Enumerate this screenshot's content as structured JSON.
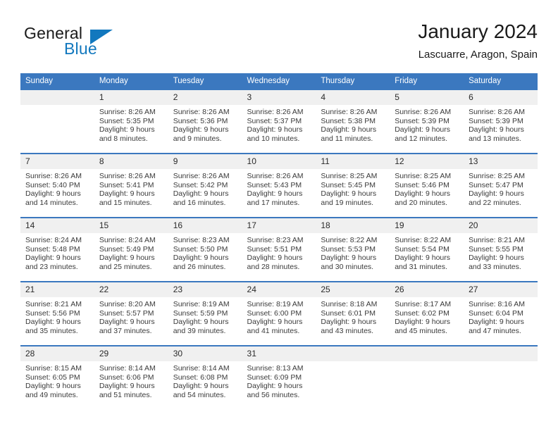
{
  "brand": {
    "name_part1": "General",
    "name_part2": "Blue",
    "color_primary": "#1278be",
    "icon": "triangle-logo"
  },
  "header": {
    "title": "January 2024",
    "subtitle": "Lascuarre, Aragon, Spain"
  },
  "theme": {
    "header_bar": "#3b78bf",
    "daynum_band": "#f0f0f0",
    "text": "#1a1a1a"
  },
  "weekday_headers": [
    "Sunday",
    "Monday",
    "Tuesday",
    "Wednesday",
    "Thursday",
    "Friday",
    "Saturday"
  ],
  "labels": {
    "sunrise_prefix": "Sunrise:",
    "sunset_prefix": "Sunset:",
    "daylight_prefix": "Daylight:"
  },
  "weeks": [
    [
      {
        "day": "",
        "l1": "",
        "l2": "",
        "l3": "",
        "l4": ""
      },
      {
        "day": "1",
        "l1": "Sunrise: 8:26 AM",
        "l2": "Sunset: 5:35 PM",
        "l3": "Daylight: 9 hours",
        "l4": "and 8 minutes."
      },
      {
        "day": "2",
        "l1": "Sunrise: 8:26 AM",
        "l2": "Sunset: 5:36 PM",
        "l3": "Daylight: 9 hours",
        "l4": "and 9 minutes."
      },
      {
        "day": "3",
        "l1": "Sunrise: 8:26 AM",
        "l2": "Sunset: 5:37 PM",
        "l3": "Daylight: 9 hours",
        "l4": "and 10 minutes."
      },
      {
        "day": "4",
        "l1": "Sunrise: 8:26 AM",
        "l2": "Sunset: 5:38 PM",
        "l3": "Daylight: 9 hours",
        "l4": "and 11 minutes."
      },
      {
        "day": "5",
        "l1": "Sunrise: 8:26 AM",
        "l2": "Sunset: 5:39 PM",
        "l3": "Daylight: 9 hours",
        "l4": "and 12 minutes."
      },
      {
        "day": "6",
        "l1": "Sunrise: 8:26 AM",
        "l2": "Sunset: 5:39 PM",
        "l3": "Daylight: 9 hours",
        "l4": "and 13 minutes."
      }
    ],
    [
      {
        "day": "7",
        "l1": "Sunrise: 8:26 AM",
        "l2": "Sunset: 5:40 PM",
        "l3": "Daylight: 9 hours",
        "l4": "and 14 minutes."
      },
      {
        "day": "8",
        "l1": "Sunrise: 8:26 AM",
        "l2": "Sunset: 5:41 PM",
        "l3": "Daylight: 9 hours",
        "l4": "and 15 minutes."
      },
      {
        "day": "9",
        "l1": "Sunrise: 8:26 AM",
        "l2": "Sunset: 5:42 PM",
        "l3": "Daylight: 9 hours",
        "l4": "and 16 minutes."
      },
      {
        "day": "10",
        "l1": "Sunrise: 8:26 AM",
        "l2": "Sunset: 5:43 PM",
        "l3": "Daylight: 9 hours",
        "l4": "and 17 minutes."
      },
      {
        "day": "11",
        "l1": "Sunrise: 8:25 AM",
        "l2": "Sunset: 5:45 PM",
        "l3": "Daylight: 9 hours",
        "l4": "and 19 minutes."
      },
      {
        "day": "12",
        "l1": "Sunrise: 8:25 AM",
        "l2": "Sunset: 5:46 PM",
        "l3": "Daylight: 9 hours",
        "l4": "and 20 minutes."
      },
      {
        "day": "13",
        "l1": "Sunrise: 8:25 AM",
        "l2": "Sunset: 5:47 PM",
        "l3": "Daylight: 9 hours",
        "l4": "and 22 minutes."
      }
    ],
    [
      {
        "day": "14",
        "l1": "Sunrise: 8:24 AM",
        "l2": "Sunset: 5:48 PM",
        "l3": "Daylight: 9 hours",
        "l4": "and 23 minutes."
      },
      {
        "day": "15",
        "l1": "Sunrise: 8:24 AM",
        "l2": "Sunset: 5:49 PM",
        "l3": "Daylight: 9 hours",
        "l4": "and 25 minutes."
      },
      {
        "day": "16",
        "l1": "Sunrise: 8:23 AM",
        "l2": "Sunset: 5:50 PM",
        "l3": "Daylight: 9 hours",
        "l4": "and 26 minutes."
      },
      {
        "day": "17",
        "l1": "Sunrise: 8:23 AM",
        "l2": "Sunset: 5:51 PM",
        "l3": "Daylight: 9 hours",
        "l4": "and 28 minutes."
      },
      {
        "day": "18",
        "l1": "Sunrise: 8:22 AM",
        "l2": "Sunset: 5:53 PM",
        "l3": "Daylight: 9 hours",
        "l4": "and 30 minutes."
      },
      {
        "day": "19",
        "l1": "Sunrise: 8:22 AM",
        "l2": "Sunset: 5:54 PM",
        "l3": "Daylight: 9 hours",
        "l4": "and 31 minutes."
      },
      {
        "day": "20",
        "l1": "Sunrise: 8:21 AM",
        "l2": "Sunset: 5:55 PM",
        "l3": "Daylight: 9 hours",
        "l4": "and 33 minutes."
      }
    ],
    [
      {
        "day": "21",
        "l1": "Sunrise: 8:21 AM",
        "l2": "Sunset: 5:56 PM",
        "l3": "Daylight: 9 hours",
        "l4": "and 35 minutes."
      },
      {
        "day": "22",
        "l1": "Sunrise: 8:20 AM",
        "l2": "Sunset: 5:57 PM",
        "l3": "Daylight: 9 hours",
        "l4": "and 37 minutes."
      },
      {
        "day": "23",
        "l1": "Sunrise: 8:19 AM",
        "l2": "Sunset: 5:59 PM",
        "l3": "Daylight: 9 hours",
        "l4": "and 39 minutes."
      },
      {
        "day": "24",
        "l1": "Sunrise: 8:19 AM",
        "l2": "Sunset: 6:00 PM",
        "l3": "Daylight: 9 hours",
        "l4": "and 41 minutes."
      },
      {
        "day": "25",
        "l1": "Sunrise: 8:18 AM",
        "l2": "Sunset: 6:01 PM",
        "l3": "Daylight: 9 hours",
        "l4": "and 43 minutes."
      },
      {
        "day": "26",
        "l1": "Sunrise: 8:17 AM",
        "l2": "Sunset: 6:02 PM",
        "l3": "Daylight: 9 hours",
        "l4": "and 45 minutes."
      },
      {
        "day": "27",
        "l1": "Sunrise: 8:16 AM",
        "l2": "Sunset: 6:04 PM",
        "l3": "Daylight: 9 hours",
        "l4": "and 47 minutes."
      }
    ],
    [
      {
        "day": "28",
        "l1": "Sunrise: 8:15 AM",
        "l2": "Sunset: 6:05 PM",
        "l3": "Daylight: 9 hours",
        "l4": "and 49 minutes."
      },
      {
        "day": "29",
        "l1": "Sunrise: 8:14 AM",
        "l2": "Sunset: 6:06 PM",
        "l3": "Daylight: 9 hours",
        "l4": "and 51 minutes."
      },
      {
        "day": "30",
        "l1": "Sunrise: 8:14 AM",
        "l2": "Sunset: 6:08 PM",
        "l3": "Daylight: 9 hours",
        "l4": "and 54 minutes."
      },
      {
        "day": "31",
        "l1": "Sunrise: 8:13 AM",
        "l2": "Sunset: 6:09 PM",
        "l3": "Daylight: 9 hours",
        "l4": "and 56 minutes."
      },
      {
        "day": "",
        "l1": "",
        "l2": "",
        "l3": "",
        "l4": ""
      },
      {
        "day": "",
        "l1": "",
        "l2": "",
        "l3": "",
        "l4": ""
      },
      {
        "day": "",
        "l1": "",
        "l2": "",
        "l3": "",
        "l4": ""
      }
    ]
  ]
}
